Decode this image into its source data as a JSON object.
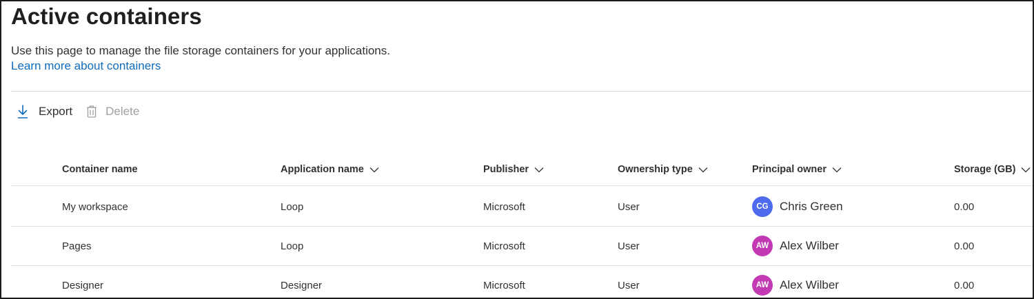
{
  "page": {
    "title": "Active containers",
    "description": "Use this page to manage the file storage containers for your applications.",
    "learn_more": "Learn more about containers"
  },
  "toolbar": {
    "export_label": "Export",
    "delete_label": "Delete"
  },
  "table": {
    "headers": {
      "container_name": "Container name",
      "application_name": "Application name",
      "publisher": "Publisher",
      "ownership_type": "Ownership type",
      "principal_owner": "Principal owner",
      "storage": "Storage (GB)"
    },
    "rows": [
      {
        "container_name": "My workspace",
        "application_name": "Loop",
        "publisher": "Microsoft",
        "ownership_type": "User",
        "owner_initials": "CG",
        "owner_name": "Chris Green",
        "owner_color": "#4f6bed",
        "storage": "0.00"
      },
      {
        "container_name": "Pages",
        "application_name": "Loop",
        "publisher": "Microsoft",
        "ownership_type": "User",
        "owner_initials": "AW",
        "owner_name": "Alex Wilber",
        "owner_color": "#c239b3",
        "storage": "0.00"
      },
      {
        "container_name": "Designer",
        "application_name": "Designer",
        "publisher": "Microsoft",
        "ownership_type": "User",
        "owner_initials": "AW",
        "owner_name": "Alex Wilber",
        "owner_color": "#c239b3",
        "storage": "0.00"
      }
    ]
  },
  "colors": {
    "link": "#0f6cbd",
    "export_icon": "#0f6cbd",
    "disabled": "#a19f9d"
  },
  "icons": {
    "export": "download-arrow-icon",
    "delete": "trash-icon",
    "sort": "chevron-down-icon"
  }
}
